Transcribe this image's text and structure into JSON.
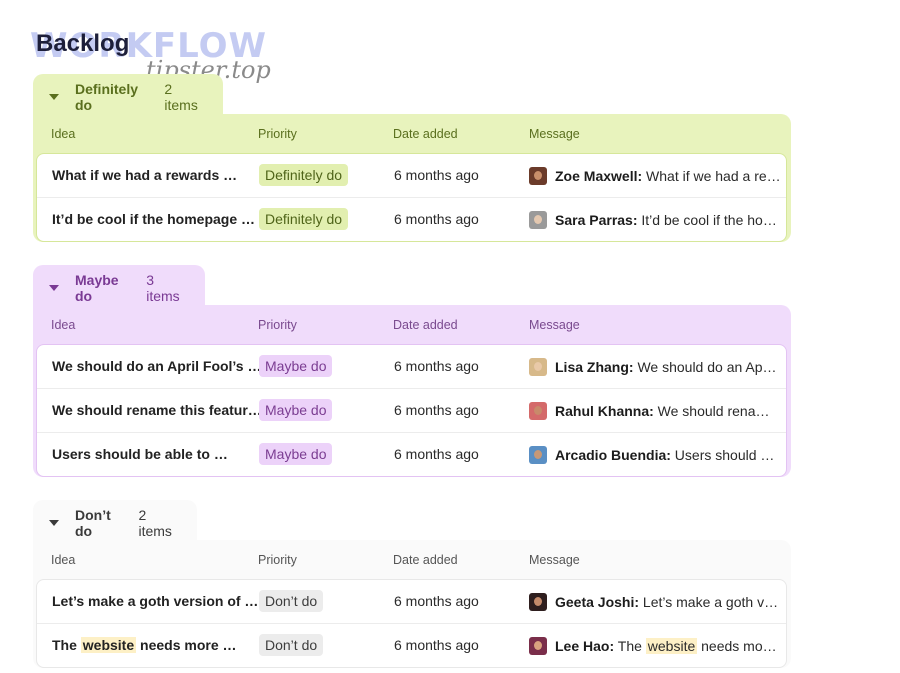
{
  "watermark": {
    "line1": "WORKFLOW",
    "line2": "tipster.top"
  },
  "page": {
    "title": "Backlog"
  },
  "columns": {
    "idea": "Idea",
    "priority": "Priority",
    "date": "Date added",
    "message": "Message"
  },
  "groups": [
    {
      "name": "Definitely do",
      "count": "2 items",
      "rows": [
        {
          "idea": "What if we had a rewards …",
          "priority": "Definitely do",
          "date": "6 months ago",
          "author": "Zoe Maxwell:",
          "message_pre": "What if we had a rew…",
          "highlight": "",
          "message_post": "",
          "avatar_color": "#6b3b2a",
          "skin": "#c98f6b"
        },
        {
          "idea": "It’d be cool if the homepage …",
          "priority": "Definitely do",
          "date": "6 months ago",
          "author": "Sara Parras:",
          "message_pre": "It’d be cool if the home…",
          "highlight": "",
          "message_post": "",
          "avatar_color": "#9a9a9a",
          "skin": "#e4c8b0"
        }
      ]
    },
    {
      "name": "Maybe do",
      "count": "3 items",
      "rows": [
        {
          "idea": "We should do an April Fool’s …",
          "priority": "Maybe do",
          "date": "6 months ago",
          "author": "Lisa Zhang:",
          "message_pre": "We should do an April F…",
          "highlight": "",
          "message_post": "",
          "avatar_color": "#d7b98a",
          "skin": "#e9c9a8"
        },
        {
          "idea": "We should rename this featur…",
          "priority": "Maybe do",
          "date": "6 months ago",
          "author": "Rahul Khanna:",
          "message_pre": "We should rename t…",
          "highlight": "",
          "message_post": "",
          "avatar_color": "#d46a6a",
          "skin": "#c88a6a"
        },
        {
          "idea": "Users should be able to …",
          "priority": "Maybe do",
          "date": "6 months ago",
          "author": "Arcadio Buendia:",
          "message_pre": "Users should be a…",
          "highlight": "",
          "message_post": "",
          "avatar_color": "#5a8fc4",
          "skin": "#c79877"
        }
      ]
    },
    {
      "name": "Don’t do",
      "count": "2 items",
      "rows": [
        {
          "idea": "Let’s make a goth version of …",
          "priority": "Don’t do",
          "date": "6 months ago",
          "author": "Geeta Joshi:",
          "message_pre": "Let’s make a goth versi…",
          "highlight": "",
          "message_post": "",
          "avatar_color": "#2e1e1e",
          "skin": "#c48a6a"
        },
        {
          "idea_pre": "The ",
          "idea_hl": "website",
          "idea_post": " needs more …",
          "priority": "Don’t do",
          "date": "6 months ago",
          "author": "Lee Hao:",
          "message_pre": "The ",
          "highlight": "website",
          "message_post": " needs more p…",
          "avatar_color": "#7a2e4a",
          "skin": "#d9a27f"
        }
      ]
    }
  ]
}
